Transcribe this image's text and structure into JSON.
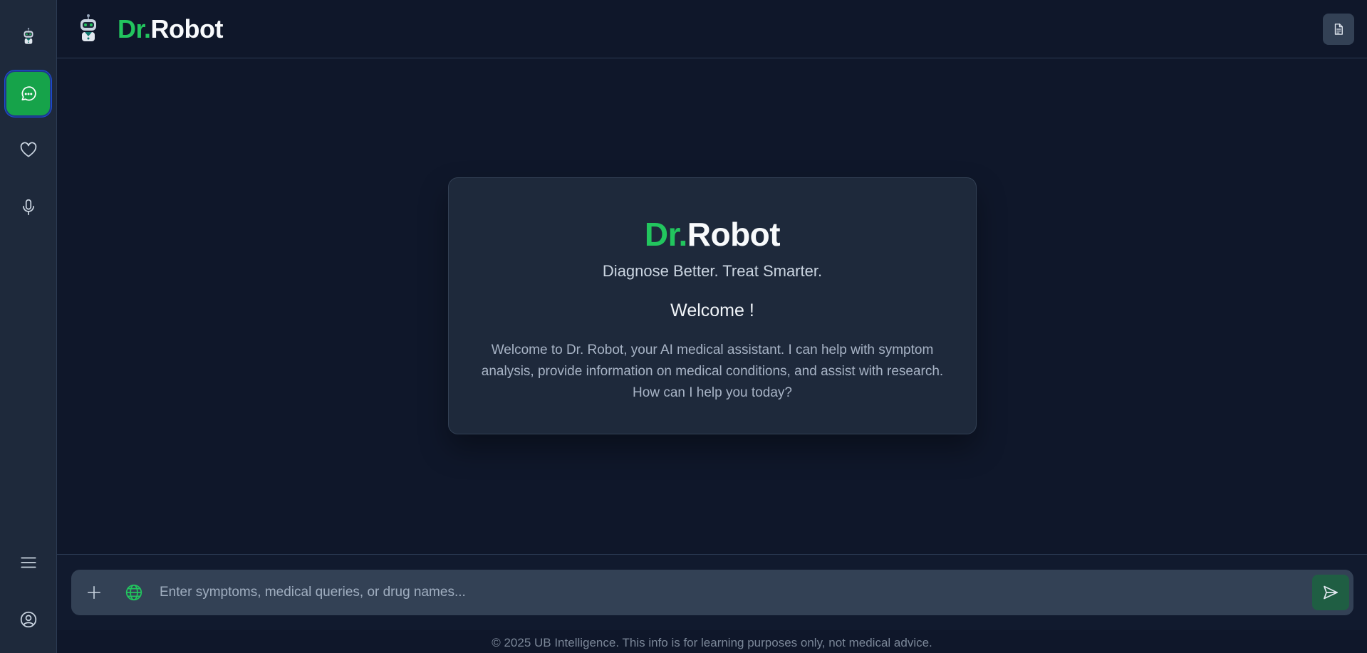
{
  "sidebar": {
    "items": [
      {
        "name": "robot-logo-icon"
      },
      {
        "name": "chat-icon",
        "active": true
      },
      {
        "name": "heart-icon"
      },
      {
        "name": "microphone-icon"
      },
      {
        "name": "menu-icon"
      },
      {
        "name": "user-icon"
      }
    ]
  },
  "header": {
    "brand_dr": "Dr.",
    "brand_robot": "Robot",
    "doc_icon": "document-icon"
  },
  "welcome": {
    "brand_dr": "Dr.",
    "brand_robot": "Robot",
    "tagline": "Diagnose Better. Treat Smarter.",
    "title": "Welcome !",
    "text": "Welcome to Dr. Robot, your AI medical assistant. I can help with symptom analysis, provide information on medical conditions, and assist with research. How can I help you today?"
  },
  "input": {
    "placeholder": "Enter symptoms, medical queries, or drug names...",
    "value": ""
  },
  "footer": {
    "text": "© 2025 UB Intelligence. This info is for learning purposes only, not medical advice."
  },
  "colors": {
    "accent": "#22c55e",
    "active_button": "#16a34a",
    "background": "#0f172a",
    "panel": "#1e293b"
  }
}
